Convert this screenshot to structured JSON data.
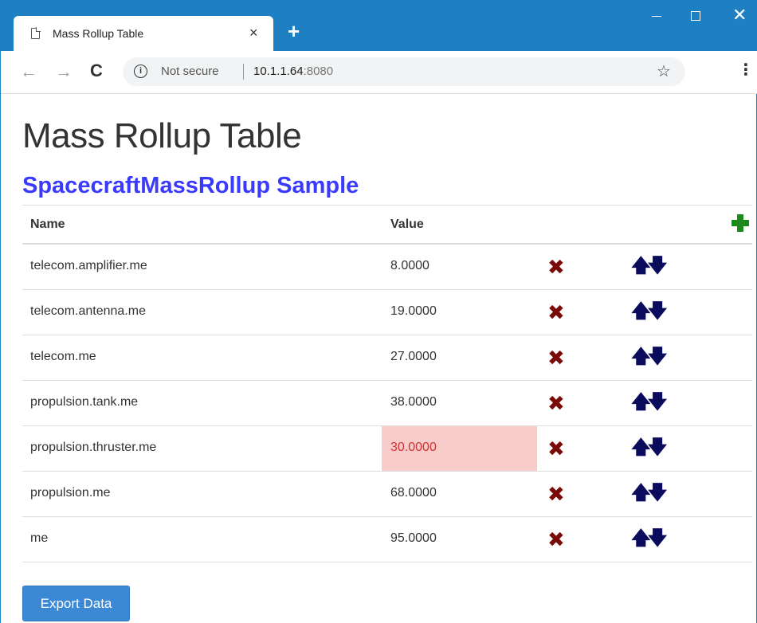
{
  "browser": {
    "tab_title": "Mass Rollup Table",
    "tab_close": "×",
    "new_tab": "+",
    "not_secure": "Not secure",
    "url_host": "10.1.1.64",
    "url_port": ":8080",
    "colors": {
      "chrome_blue": "#1e7fc3"
    }
  },
  "page": {
    "title": "Mass Rollup Table",
    "subtitle": "SpacecraftMassRollup Sample",
    "subtitle_color": "#3a3aff"
  },
  "table": {
    "headers": {
      "name": "Name",
      "value": "Value"
    },
    "rows": [
      {
        "name": "telecom.amplifier.me",
        "value": "8.0000",
        "error": false
      },
      {
        "name": "telecom.antenna.me",
        "value": "19.0000",
        "error": false
      },
      {
        "name": "telecom.me",
        "value": "27.0000",
        "error": false
      },
      {
        "name": "propulsion.tank.me",
        "value": "38.0000",
        "error": false
      },
      {
        "name": "propulsion.thruster.me",
        "value": "30.0000",
        "error": true
      },
      {
        "name": "propulsion.me",
        "value": "68.0000",
        "error": false
      },
      {
        "name": "me",
        "value": "95.0000",
        "error": false
      }
    ],
    "icons": {
      "add": "plus-icon",
      "delete": "x-icon",
      "move_up": "arrow-up-icon",
      "move_down": "arrow-down-icon"
    },
    "colors": {
      "add": "#1a8a1a",
      "delete": "#7a0a0a",
      "arrows": "#0b0b5e",
      "error_bg": "#f9cccc",
      "error_text": "#d13030"
    }
  },
  "actions": {
    "export_label": "Export Data"
  }
}
